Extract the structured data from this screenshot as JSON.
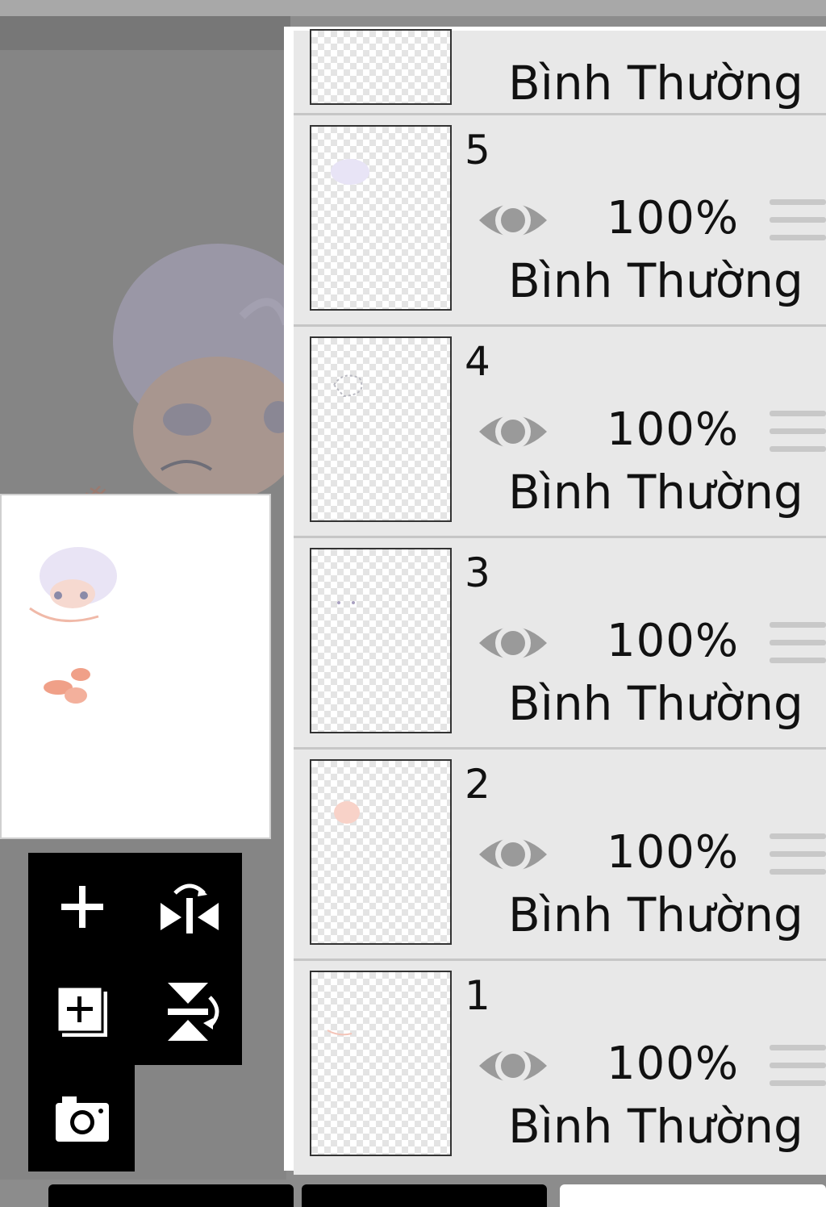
{
  "layers_panel": {
    "top_partial": {
      "blend_mode": "Bình Thường"
    },
    "layers": [
      {
        "number": "5",
        "opacity": "100%",
        "blend_mode": "Bình Thường",
        "visible": true
      },
      {
        "number": "4",
        "opacity": "100%",
        "blend_mode": "Bình Thường",
        "visible": true
      },
      {
        "number": "3",
        "opacity": "100%",
        "blend_mode": "Bình Thường",
        "visible": true
      },
      {
        "number": "2",
        "opacity": "100%",
        "blend_mode": "Bình Thường",
        "visible": true
      },
      {
        "number": "1",
        "opacity": "100%",
        "blend_mode": "Bình Thường",
        "visible": true
      }
    ]
  },
  "toolbox": {
    "icons": [
      "add-layer-icon",
      "flip-horizontal-icon",
      "add-copy-layer-icon",
      "flip-vertical-icon",
      "camera-icon"
    ]
  },
  "colors": {
    "panel_bg": "#e8e8e8",
    "canvas_bg": "#858585",
    "eye": "#9a9a9a",
    "toolbox_bg": "#000000"
  }
}
